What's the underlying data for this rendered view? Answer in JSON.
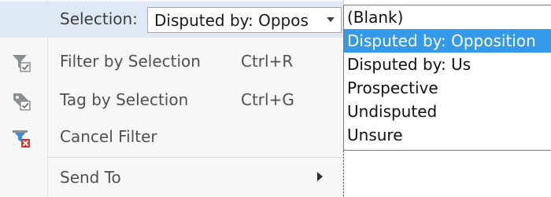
{
  "menu": {
    "selection": {
      "label": "Selection:",
      "value": "Disputed by:  Oppos"
    },
    "filter_by_selection": {
      "label": "Filter by Selection",
      "shortcut": "Ctrl+R",
      "icon": "filter-check-icon"
    },
    "tag_by_selection": {
      "label": "Tag by Selection",
      "shortcut": "Ctrl+G",
      "icon": "tag-check-icon"
    },
    "cancel_filter": {
      "label": "Cancel Filter",
      "icon": "filter-cancel-icon"
    },
    "send_to": {
      "label": "Send To"
    }
  },
  "dropdown": {
    "options": [
      "(Blank)",
      "Disputed by:  Opposition",
      "Disputed by:  Us",
      "Prospective",
      "Undisputed",
      "Unsure"
    ],
    "selected_index": 1
  },
  "colors": {
    "menu_background": "#f7f7f7",
    "selection_row_highlight": "#dfe9f6",
    "option_selected": "#3399e8",
    "combo_border": "#7eb4ea"
  }
}
